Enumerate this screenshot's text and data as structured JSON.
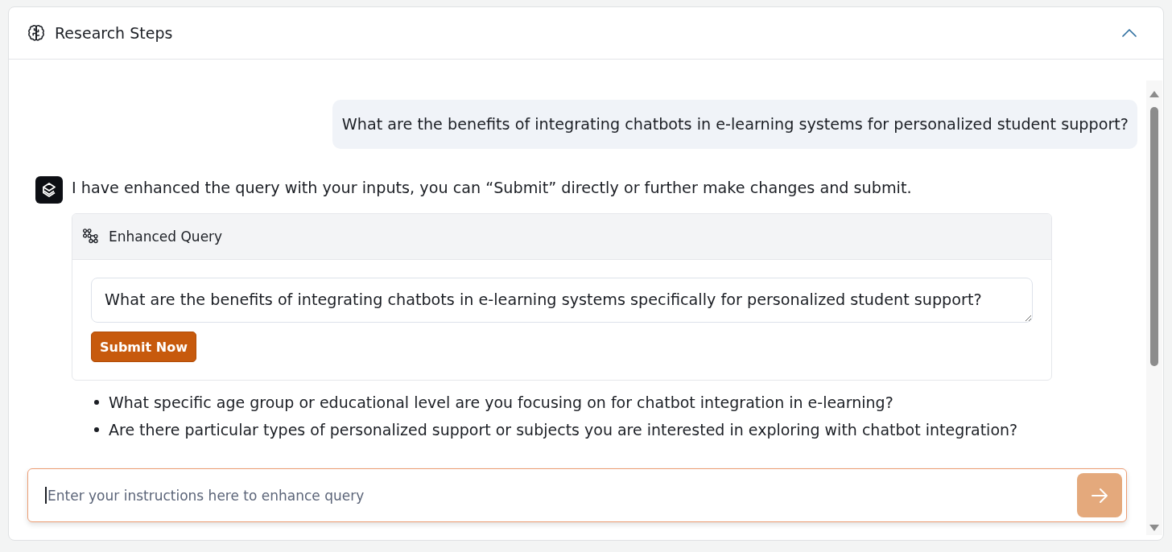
{
  "panel": {
    "title": "Research Steps",
    "expanded": true
  },
  "conversation": [
    {
      "kind": "user",
      "text": "What are the benefits of integrating chatbots in e-learning systems for personalized student support?"
    },
    {
      "kind": "assistant",
      "text": "I have enhanced the query with your inputs, you can “Submit” directly or further make changes and submit.",
      "enhanced_query": {
        "title": "Enhanced Query",
        "value": "What are the benefits of integrating chatbots in e-learning systems specifically for personalized student support?",
        "submit_label": "Submit Now"
      },
      "follow_up_questions": [
        "What specific age group or educational level are you focusing on for chatbot integration in e-learning?",
        "Are there particular types of personalized support or subjects you are interested in exploring with chatbot integration?"
      ]
    }
  ],
  "composer": {
    "placeholder": "Enter your instructions here to enhance query",
    "focused": true,
    "send_button": {
      "disabled": true
    }
  }
}
